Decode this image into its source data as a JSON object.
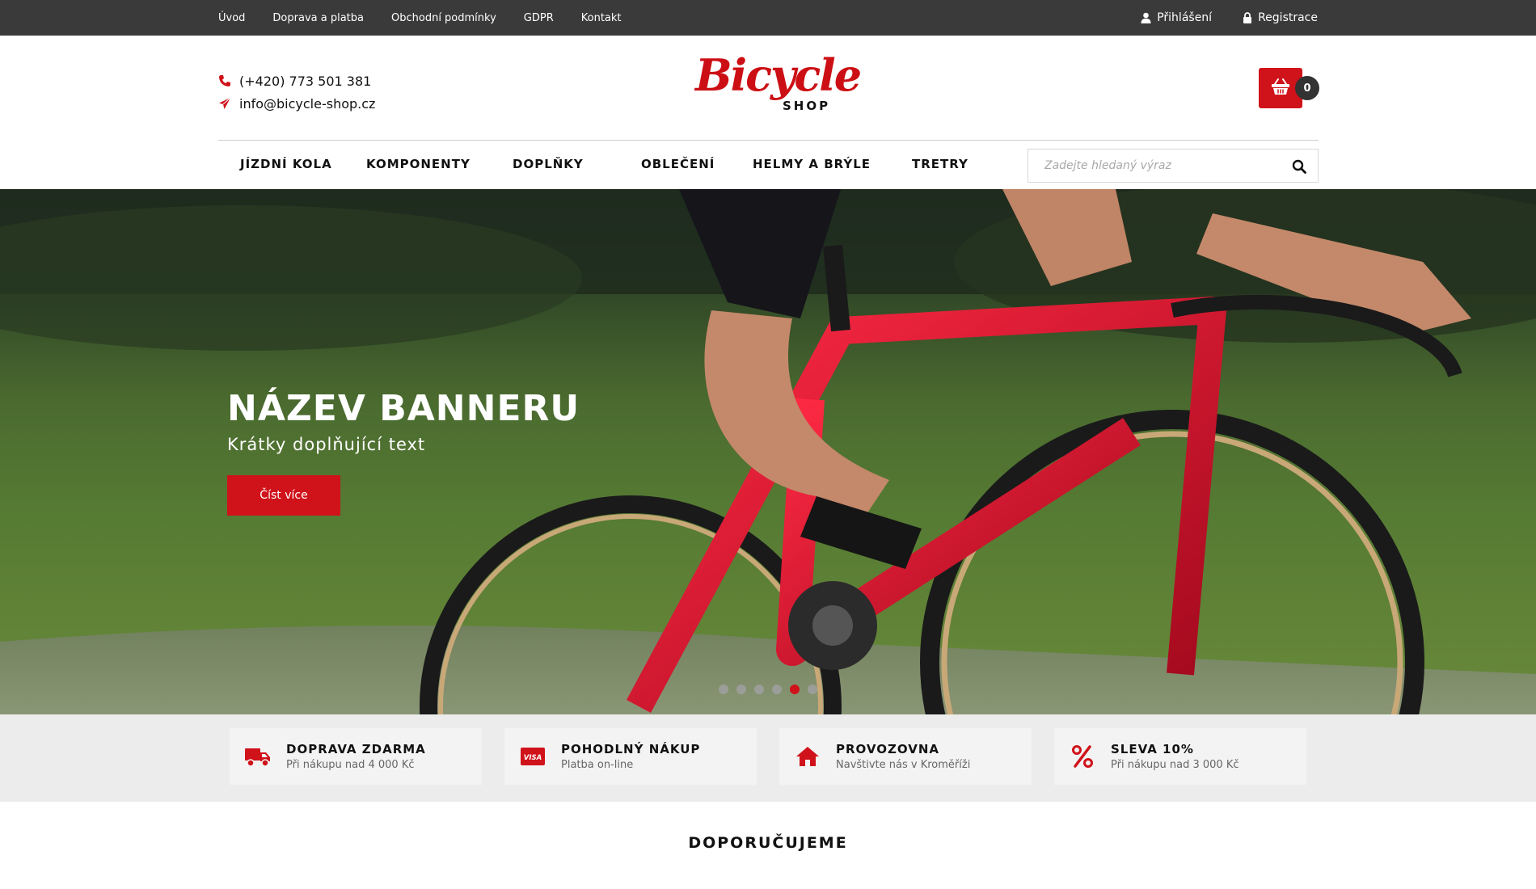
{
  "topbar": {
    "links": [
      "Úvod",
      "Doprava a platba",
      "Obchodní podmínky",
      "GDPR",
      "Kontakt"
    ],
    "login": "Přihlášení",
    "register": "Registrace"
  },
  "header": {
    "phone": "(+420) 773 501 381",
    "email": "info@bicycle-shop.cz",
    "logo_script": "Bicycle",
    "logo_sub": "SHOP",
    "cart_count": "0"
  },
  "nav": {
    "items": [
      "JÍZDNÍ KOLA",
      "KOMPONENTY",
      "DOPLŇKY",
      "OBLEČENÍ",
      "HELMY A BRÝLE",
      "TRETRY"
    ],
    "search_placeholder": "Zadejte hledaný výraz"
  },
  "hero": {
    "title": "NÁZEV BANNERU",
    "subtitle": "Krátky doplňující text",
    "cta": "Číst více",
    "slides": 6,
    "active_slide": 5
  },
  "features": [
    {
      "icon": "truck-icon",
      "title": "DOPRAVA ZDARMA",
      "subtitle": "Při nákupu nad 4 000 Kč"
    },
    {
      "icon": "visa-icon",
      "title": "POHODLNÝ NÁKUP",
      "subtitle": "Platba on-line"
    },
    {
      "icon": "home-icon",
      "title": "PROVOZOVNA",
      "subtitle": "Navštivte nás v Kroměříži"
    },
    {
      "icon": "percent-icon",
      "title": "SLEVA 10%",
      "subtitle": "Při nákupu nad 3 000 Kč"
    }
  ],
  "recommended": {
    "title": "DOPORUČUJEME"
  },
  "colors": {
    "accent": "#d0121a",
    "topbar": "#3a3a3a",
    "features_bg": "#ececec"
  }
}
